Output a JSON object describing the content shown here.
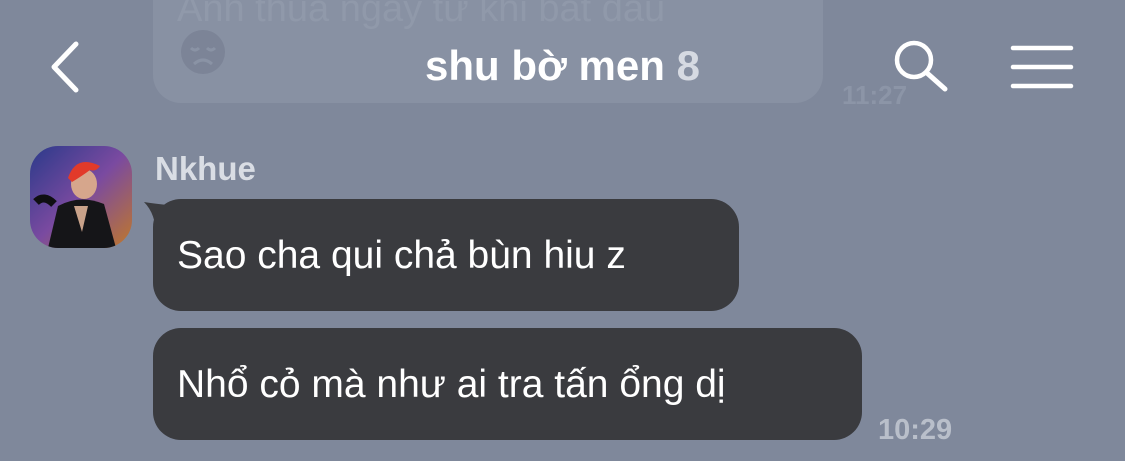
{
  "header": {
    "title": "shu bờ men",
    "member_count": "8",
    "back_icon": "chevron-left-icon",
    "search_icon": "search-icon",
    "menu_icon": "hamburger-menu-icon"
  },
  "previous_message": {
    "text": "Anh thua ngay từ khi bắt đầu",
    "emoji": "sad-face-emoji",
    "time": "11:27"
  },
  "messages": [
    {
      "sender": "Nkhue",
      "text": "Sao cha qui chả bùn hiu z"
    },
    {
      "text": "Nhổ cỏ mà như ai tra tấn ổng dị",
      "time": "10:29"
    }
  ],
  "colors": {
    "background": "#7f889b",
    "bubble": "#3a3b3f",
    "text": "#ffffff"
  }
}
